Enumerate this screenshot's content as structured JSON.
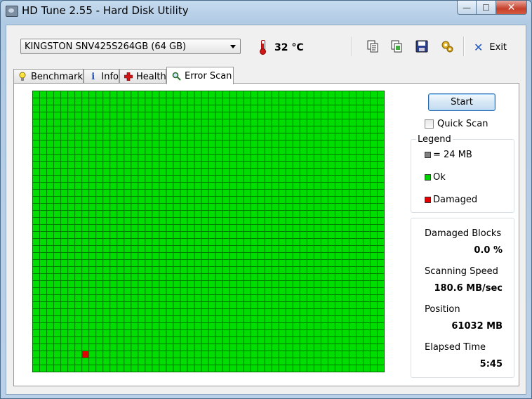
{
  "window": {
    "title": "HD Tune 2.55 - Hard Disk Utility",
    "min_glyph": "—",
    "max_glyph": "☐",
    "close_glyph": "✕"
  },
  "toolbar": {
    "drive": "KINGSTON SNV425S264GB (64 GB)",
    "temperature": "32 °C",
    "icons": [
      "copy-text-icon",
      "copy-screenshot-icon",
      "save-icon",
      "options-icon"
    ],
    "exit_label": "Exit"
  },
  "tabs": [
    {
      "label": "Benchmark",
      "icon": "lightbulb-icon"
    },
    {
      "label": "Info",
      "icon": "info-icon"
    },
    {
      "label": "Health",
      "icon": "health-cross-icon"
    },
    {
      "label": "Error Scan",
      "icon": "magnifier-icon",
      "active": true
    }
  ],
  "scan": {
    "start_label": "Start",
    "quick_scan_label": "Quick Scan",
    "quick_scan_checked": false,
    "legend_title": "Legend",
    "legend": [
      {
        "label": "= 24 MB",
        "color": "#808080"
      },
      {
        "label": "Ok",
        "color": "#00d000"
      },
      {
        "label": "Damaged",
        "color": "#e00000"
      }
    ],
    "grid": {
      "columns": 50,
      "rows": 40,
      "ok_color": "#00dd00",
      "damaged_color": "#e00000",
      "damaged_blocks": [
        {
          "row": 37,
          "col": 7
        }
      ]
    },
    "stats": {
      "damaged_blocks_label": "Damaged Blocks",
      "damaged_blocks_value": "0.0 %",
      "scanning_speed_label": "Scanning Speed",
      "scanning_speed_value": "180.6 MB/sec",
      "position_label": "Position",
      "position_value": "61032 MB",
      "elapsed_label": "Elapsed Time",
      "elapsed_value": "5:45"
    }
  }
}
